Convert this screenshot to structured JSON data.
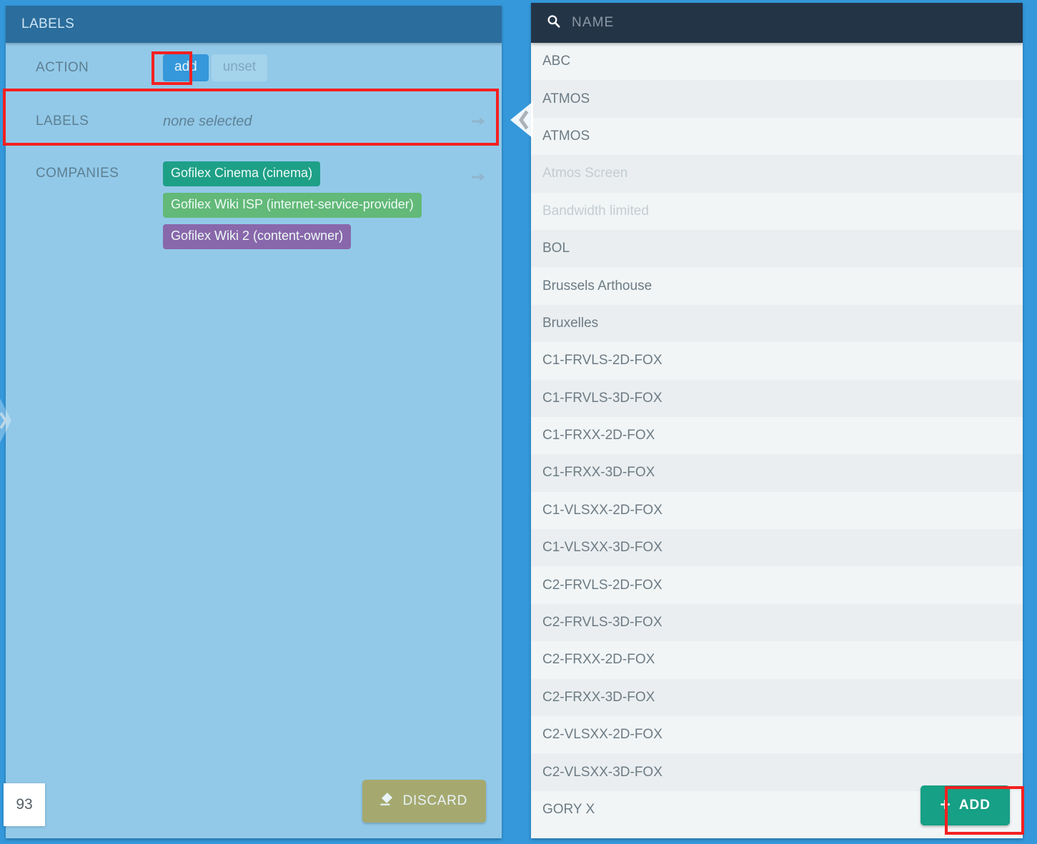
{
  "page": {
    "background_color": "#3498db"
  },
  "left_panel": {
    "header": {
      "title": "LABELS",
      "background_color": "#2b6d9c"
    },
    "rows": {
      "action": {
        "label": "ACTION",
        "options": [
          {
            "label": "add",
            "state": "active",
            "color": "#3498db"
          },
          {
            "label": "unset",
            "state": "inactive",
            "color": "#a4d3ec"
          }
        ]
      },
      "labels": {
        "label": "LABELS",
        "value": "none selected",
        "arrow_icon": "arrow-right-icon"
      },
      "companies": {
        "label": "COMPANIES",
        "arrow_icon": "arrow-right-icon",
        "tags": [
          {
            "text": "Gofilex Cinema (cinema)",
            "color": "#1ea087"
          },
          {
            "text": "Gofilex Wiki ISP (internet-service-provider)",
            "color": "#62b978"
          },
          {
            "text": "Gofilex Wiki 2 (content-owner)",
            "color": "#8967ab"
          }
        ]
      }
    },
    "discard_button": {
      "label": "DISCARD",
      "icon": "eraser-icon",
      "color": "#a5a96f"
    },
    "collapse_tab_icon": "chevron-left-icon"
  },
  "right_panel": {
    "search": {
      "placeholder": "NAME",
      "value": "",
      "icon": "search-icon"
    },
    "count_badge": "93",
    "add_button": {
      "label": "ADD",
      "icon": "plus-icon",
      "color": "#16a085"
    },
    "items": [
      {
        "name": "ABC",
        "disabled": false
      },
      {
        "name": "ATMOS",
        "disabled": false
      },
      {
        "name": "ATMOS",
        "disabled": false
      },
      {
        "name": "Atmos Screen",
        "disabled": true
      },
      {
        "name": "Bandwidth limited",
        "disabled": true
      },
      {
        "name": "BOL",
        "disabled": false
      },
      {
        "name": "Brussels Arthouse",
        "disabled": false
      },
      {
        "name": "Bruxelles",
        "disabled": false
      },
      {
        "name": "C1-FRVLS-2D-FOX",
        "disabled": false
      },
      {
        "name": "C1-FRVLS-3D-FOX",
        "disabled": false
      },
      {
        "name": "C1-FRXX-2D-FOX",
        "disabled": false
      },
      {
        "name": "C1-FRXX-3D-FOX",
        "disabled": false
      },
      {
        "name": "C1-VLSXX-2D-FOX",
        "disabled": false
      },
      {
        "name": "C1-VLSXX-3D-FOX",
        "disabled": false
      },
      {
        "name": "C2-FRVLS-2D-FOX",
        "disabled": false
      },
      {
        "name": "C2-FRVLS-3D-FOX",
        "disabled": false
      },
      {
        "name": "C2-FRXX-2D-FOX",
        "disabled": false
      },
      {
        "name": "C2-FRXX-3D-FOX",
        "disabled": false
      },
      {
        "name": "C2-VLSXX-2D-FOX",
        "disabled": false
      },
      {
        "name": "C2-VLSXX-3D-FOX",
        "disabled": false
      },
      {
        "name": "GORY X",
        "disabled": false
      }
    ]
  },
  "highlights": {
    "color": "#f42020",
    "targets": [
      "add-toggle-button",
      "labels-row",
      "add-button"
    ]
  }
}
